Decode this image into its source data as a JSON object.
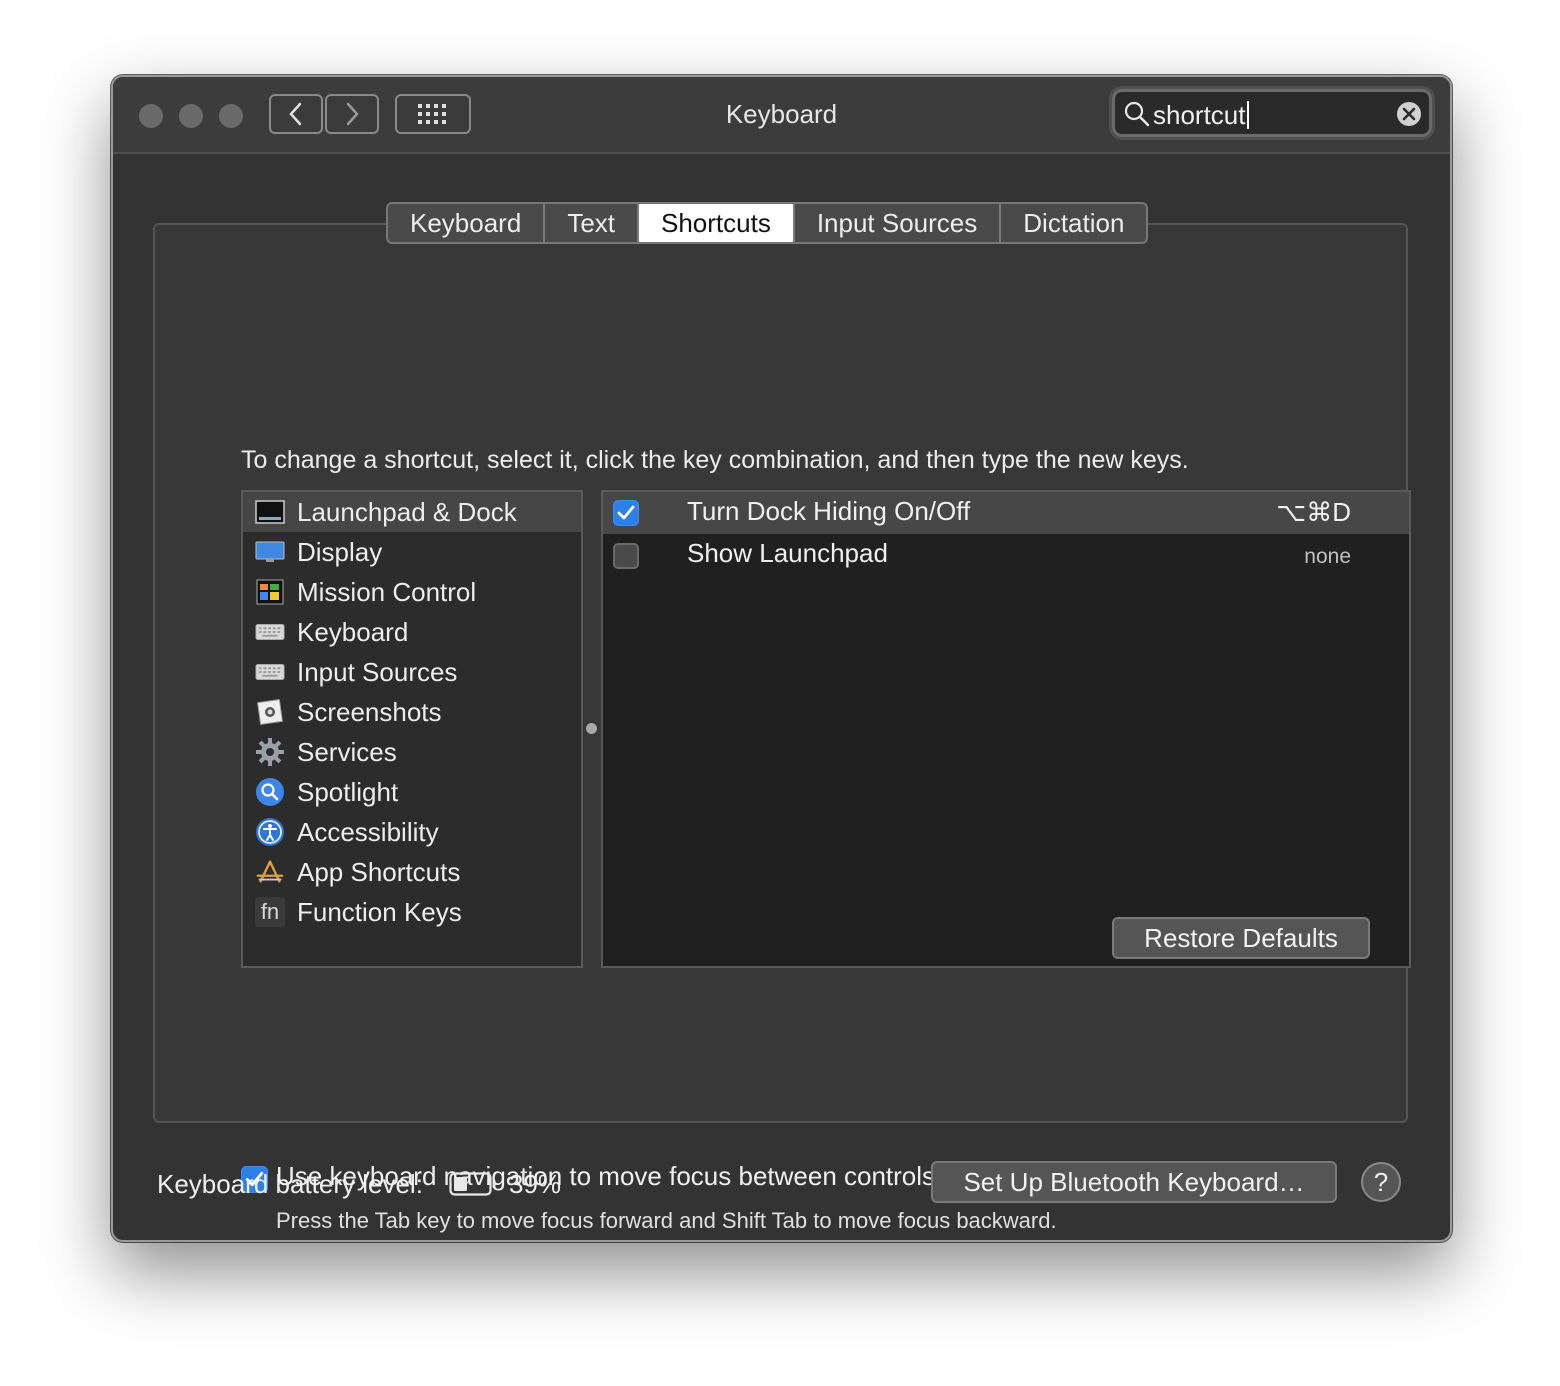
{
  "window": {
    "title": "Keyboard"
  },
  "toolbar": {
    "back_icon": "chevron-left-icon",
    "forward_icon": "chevron-right-icon",
    "show_all_icon": "grid-icon"
  },
  "search": {
    "value": "shortcut",
    "icon": "magnifier-icon",
    "clear_icon": "clear-icon"
  },
  "tabs": [
    {
      "label": "Keyboard",
      "active": false
    },
    {
      "label": "Text",
      "active": false
    },
    {
      "label": "Shortcuts",
      "active": true
    },
    {
      "label": "Input Sources",
      "active": false
    },
    {
      "label": "Dictation",
      "active": false
    }
  ],
  "shortcuts": {
    "instructions": "To change a shortcut, select it, click the key combination, and then type the new keys.",
    "categories": [
      {
        "label": "Launchpad & Dock",
        "icon": "launchpad-dock-icon",
        "selected": true
      },
      {
        "label": "Display",
        "icon": "display-icon",
        "selected": false
      },
      {
        "label": "Mission Control",
        "icon": "mission-control-icon",
        "selected": false
      },
      {
        "label": "Keyboard",
        "icon": "keyboard-icon",
        "selected": false
      },
      {
        "label": "Input Sources",
        "icon": "input-sources-icon",
        "selected": false
      },
      {
        "label": "Screenshots",
        "icon": "screenshots-icon",
        "selected": false
      },
      {
        "label": "Services",
        "icon": "gear-icon",
        "selected": false
      },
      {
        "label": "Spotlight",
        "icon": "spotlight-icon",
        "selected": false
      },
      {
        "label": "Accessibility",
        "icon": "accessibility-icon",
        "selected": false
      },
      {
        "label": "App Shortcuts",
        "icon": "app-store-icon",
        "selected": false
      },
      {
        "label": "Function Keys",
        "icon": "fn-icon",
        "fn_text": "fn",
        "selected": false
      }
    ],
    "items": [
      {
        "name": "Turn Dock Hiding On/Off",
        "keys": "⌥⌘D",
        "checked": true,
        "selected": true
      },
      {
        "name": "Show Launchpad",
        "keys": "none",
        "checked": false,
        "selected": false
      }
    ],
    "restore_label": "Restore Defaults"
  },
  "navigation": {
    "checked": true,
    "label": "Use keyboard navigation to move focus between controls",
    "hint": "Press the Tab key to move focus forward and Shift Tab to move focus backward."
  },
  "footer": {
    "battery_label": "Keyboard battery level:",
    "battery_percent": "39%",
    "battery_level": 0.39,
    "bluetooth_label": "Set Up Bluetooth Keyboard…",
    "help_label": "?"
  },
  "colors": {
    "accent": "#2f7fe9",
    "window_bg": "#333333"
  }
}
